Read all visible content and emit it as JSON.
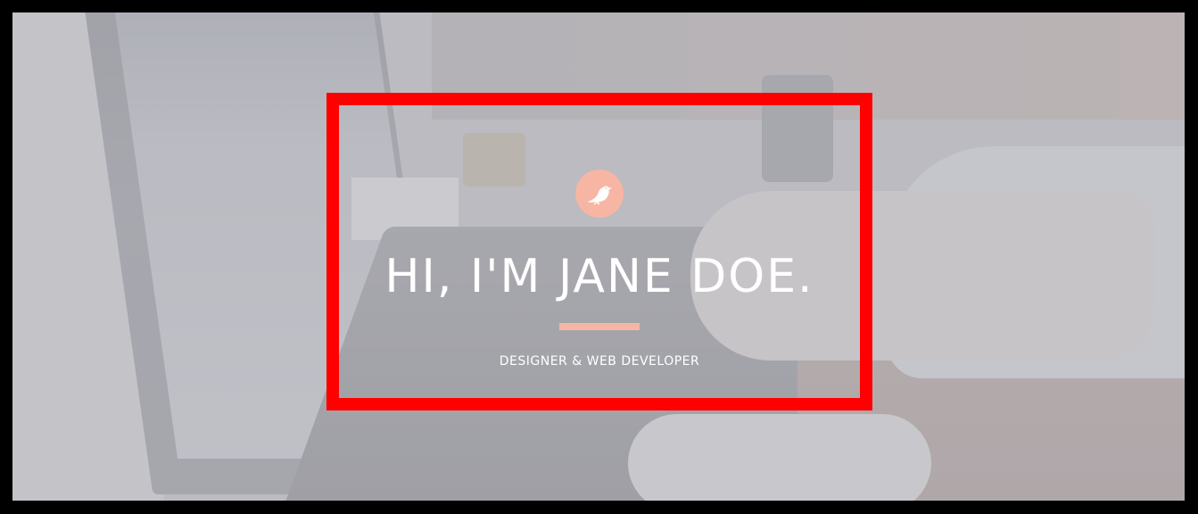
{
  "hero": {
    "logo_icon": "bird-icon",
    "headline": "HI, I'M JANE DOE.",
    "tagline": "DESIGNER & WEB DEVELOPER"
  },
  "colors": {
    "accent": "#f7b6a3",
    "highlight_frame": "#ff0000",
    "text": "#ffffff"
  }
}
